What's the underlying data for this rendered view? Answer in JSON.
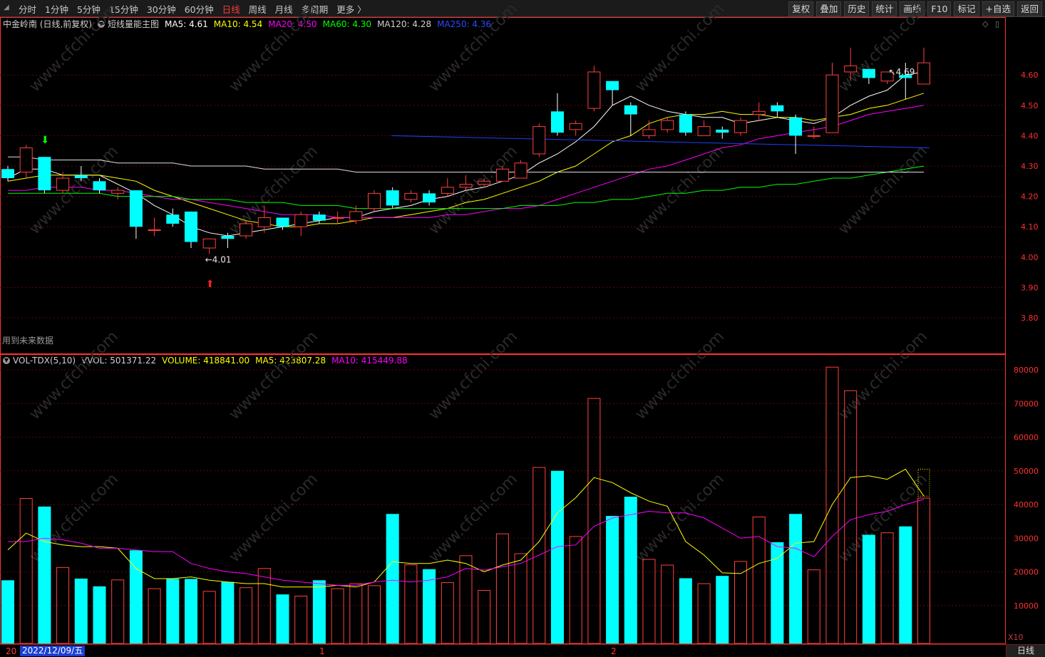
{
  "toolbar": {
    "periods": [
      {
        "label": "分时"
      },
      {
        "label": "1分钟"
      },
      {
        "label": "5分钟"
      },
      {
        "label": "15分钟"
      },
      {
        "label": "30分钟"
      },
      {
        "label": "60分钟"
      },
      {
        "label": "日线",
        "active": true
      },
      {
        "label": "周线"
      },
      {
        "label": "月线"
      },
      {
        "label": "多周期"
      },
      {
        "label": "更多 〉"
      }
    ],
    "buttons": [
      {
        "label": "复权"
      },
      {
        "label": "叠加"
      },
      {
        "label": "历史"
      },
      {
        "label": "统计"
      },
      {
        "label": "画线"
      },
      {
        "label": "F10"
      },
      {
        "label": "标记"
      },
      {
        "label": "+自选"
      },
      {
        "label": "返回"
      }
    ]
  },
  "main_legend": {
    "title": "中金岭南 (日线,前复权)",
    "indicator": "短线量能主图",
    "ma5": "MA5: 4.61",
    "ma10": "MA10: 4.54",
    "ma20": "MA20: 4.50",
    "ma60": "MA60: 4.30",
    "ma120": "MA120: 4.28",
    "ma250": "MA250: 4.36"
  },
  "vol_legend": {
    "name": "VOL-TDX(5,10)",
    "vvol": "VVOL: 501371.22",
    "volume": "VOLUME: 418841.00",
    "ma5": "MA5: 423807.28",
    "ma10": "MA10: 415449.88"
  },
  "future_data_note": "用到未来数据",
  "bottom": {
    "date": "2022/12/09/五",
    "year_prefix": "20",
    "month1": "1",
    "month2": "2",
    "period": "日线"
  },
  "x10_label": "X10",
  "colors": {
    "up": "#ff4040",
    "down": "#00ffff",
    "ma5": "#ffffff",
    "ma10": "#ffff00",
    "ma20": "#ff00ff",
    "ma60": "#00ff00",
    "ma120": "#e0e0e0",
    "ma250": "#2040ff",
    "grid": "#5a0a0a",
    "axis": "#ff3030"
  },
  "chart_data": [
    {
      "type": "candlestick",
      "title": "短线量能主图",
      "y_ticks": [
        3.8,
        3.9,
        4.0,
        4.1,
        4.2,
        4.3,
        4.4,
        4.5,
        4.6
      ],
      "ylim": [
        3.75,
        4.78
      ],
      "annotations": [
        {
          "text": "4.69",
          "at_index": 48
        },
        {
          "text": "4.01",
          "at_index": 11
        }
      ],
      "signals": [
        {
          "type": "sell-arrow",
          "index": 2
        },
        {
          "type": "buy-arrow",
          "index": 11
        }
      ],
      "candles": [
        {
          "o": 4.29,
          "c": 4.26,
          "h": 4.3,
          "l": 4.25
        },
        {
          "o": 4.28,
          "c": 4.36,
          "h": 4.37,
          "l": 4.26
        },
        {
          "o": 4.33,
          "c": 4.22,
          "h": 4.33,
          "l": 4.21
        },
        {
          "o": 4.22,
          "c": 4.26,
          "h": 4.28,
          "l": 4.21
        },
        {
          "o": 4.27,
          "c": 4.26,
          "h": 4.3,
          "l": 4.25
        },
        {
          "o": 4.25,
          "c": 4.22,
          "h": 4.26,
          "l": 4.21
        },
        {
          "o": 4.21,
          "c": 4.22,
          "h": 4.23,
          "l": 4.19
        },
        {
          "o": 4.22,
          "c": 4.1,
          "h": 4.22,
          "l": 4.06
        },
        {
          "o": 4.09,
          "c": 4.09,
          "h": 4.13,
          "l": 4.07
        },
        {
          "o": 4.14,
          "c": 4.11,
          "h": 4.16,
          "l": 4.1
        },
        {
          "o": 4.15,
          "c": 4.05,
          "h": 4.15,
          "l": 4.03
        },
        {
          "o": 4.03,
          "c": 4.06,
          "h": 4.06,
          "l": 4.01
        },
        {
          "o": 4.07,
          "c": 4.06,
          "h": 4.08,
          "l": 4.03
        },
        {
          "o": 4.07,
          "c": 4.11,
          "h": 4.12,
          "l": 4.06
        },
        {
          "o": 4.1,
          "c": 4.13,
          "h": 4.17,
          "l": 4.08
        },
        {
          "o": 4.13,
          "c": 4.1,
          "h": 4.13,
          "l": 4.09
        },
        {
          "o": 4.1,
          "c": 4.14,
          "h": 4.15,
          "l": 4.07
        },
        {
          "o": 4.14,
          "c": 4.12,
          "h": 4.15,
          "l": 4.11
        },
        {
          "o": 4.13,
          "c": 4.13,
          "h": 4.15,
          "l": 4.11
        },
        {
          "o": 4.12,
          "c": 4.15,
          "h": 4.17,
          "l": 4.11
        },
        {
          "o": 4.16,
          "c": 4.21,
          "h": 4.22,
          "l": 4.15
        },
        {
          "o": 4.22,
          "c": 4.17,
          "h": 4.23,
          "l": 4.16
        },
        {
          "o": 4.19,
          "c": 4.21,
          "h": 4.22,
          "l": 4.18
        },
        {
          "o": 4.21,
          "c": 4.18,
          "h": 4.22,
          "l": 4.17
        },
        {
          "o": 4.21,
          "c": 4.23,
          "h": 4.26,
          "l": 4.2
        },
        {
          "o": 4.23,
          "c": 4.24,
          "h": 4.27,
          "l": 4.22
        },
        {
          "o": 4.24,
          "c": 4.25,
          "h": 4.26,
          "l": 4.23
        },
        {
          "o": 4.25,
          "c": 4.29,
          "h": 4.3,
          "l": 4.25
        },
        {
          "o": 4.26,
          "c": 4.31,
          "h": 4.32,
          "l": 4.26
        },
        {
          "o": 4.34,
          "c": 4.43,
          "h": 4.44,
          "l": 4.33
        },
        {
          "o": 4.48,
          "c": 4.41,
          "h": 4.54,
          "l": 4.4
        },
        {
          "o": 4.42,
          "c": 4.44,
          "h": 4.45,
          "l": 4.4
        },
        {
          "o": 4.49,
          "c": 4.61,
          "h": 4.63,
          "l": 4.48
        },
        {
          "o": 4.58,
          "c": 4.55,
          "h": 4.58,
          "l": 4.5
        },
        {
          "o": 4.5,
          "c": 4.47,
          "h": 4.51,
          "l": 4.4
        },
        {
          "o": 4.4,
          "c": 4.42,
          "h": 4.45,
          "l": 4.39
        },
        {
          "o": 4.42,
          "c": 4.45,
          "h": 4.46,
          "l": 4.41
        },
        {
          "o": 4.47,
          "c": 4.41,
          "h": 4.48,
          "l": 4.4
        },
        {
          "o": 4.4,
          "c": 4.43,
          "h": 4.45,
          "l": 4.4
        },
        {
          "o": 4.42,
          "c": 4.41,
          "h": 4.43,
          "l": 4.39
        },
        {
          "o": 4.41,
          "c": 4.45,
          "h": 4.46,
          "l": 4.4
        },
        {
          "o": 4.47,
          "c": 4.48,
          "h": 4.51,
          "l": 4.45
        },
        {
          "o": 4.5,
          "c": 4.48,
          "h": 4.51,
          "l": 4.46
        },
        {
          "o": 4.46,
          "c": 4.4,
          "h": 4.47,
          "l": 4.34
        },
        {
          "o": 4.4,
          "c": 4.4,
          "h": 4.43,
          "l": 4.39
        },
        {
          "o": 4.41,
          "c": 4.6,
          "h": 4.64,
          "l": 4.41
        },
        {
          "o": 4.61,
          "c": 4.63,
          "h": 4.69,
          "l": 4.58
        },
        {
          "o": 4.62,
          "c": 4.59,
          "h": 4.62,
          "l": 4.57
        },
        {
          "o": 4.58,
          "c": 4.61,
          "h": 4.61,
          "l": 4.57
        },
        {
          "o": 4.6,
          "c": 4.59,
          "h": 4.64,
          "l": 4.52
        },
        {
          "o": 4.57,
          "c": 4.64,
          "h": 4.69,
          "l": 4.57
        }
      ],
      "ma_lines": {
        "ma5": [
          4.26,
          4.29,
          4.29,
          4.27,
          4.27,
          4.27,
          4.24,
          4.21,
          4.17,
          4.14,
          4.1,
          4.08,
          4.07,
          4.08,
          4.09,
          4.1,
          4.11,
          4.12,
          4.13,
          4.13,
          4.15,
          4.16,
          4.17,
          4.19,
          4.2,
          4.22,
          4.23,
          4.25,
          4.27,
          4.31,
          4.34,
          4.38,
          4.43,
          4.5,
          4.53,
          4.5,
          4.48,
          4.47,
          4.46,
          4.46,
          4.44,
          4.45,
          4.46,
          4.45,
          4.44,
          4.46,
          4.5,
          4.53,
          4.55,
          4.6,
          4.61
        ],
        "ma10": [
          4.25,
          4.26,
          4.27,
          4.27,
          4.27,
          4.27,
          4.26,
          4.25,
          4.22,
          4.2,
          4.18,
          4.16,
          4.14,
          4.12,
          4.11,
          4.1,
          4.1,
          4.11,
          4.11,
          4.12,
          4.13,
          4.13,
          4.14,
          4.15,
          4.16,
          4.18,
          4.19,
          4.21,
          4.23,
          4.25,
          4.28,
          4.3,
          4.34,
          4.38,
          4.4,
          4.44,
          4.46,
          4.47,
          4.47,
          4.48,
          4.47,
          4.47,
          4.46,
          4.46,
          4.45,
          4.46,
          4.47,
          4.49,
          4.5,
          4.52,
          4.54
        ],
        "ma20": [
          4.22,
          4.22,
          4.23,
          4.23,
          4.23,
          4.22,
          4.22,
          4.21,
          4.2,
          4.19,
          4.19,
          4.18,
          4.17,
          4.16,
          4.15,
          4.14,
          4.14,
          4.14,
          4.13,
          4.13,
          4.13,
          4.13,
          4.13,
          4.13,
          4.14,
          4.14,
          4.15,
          4.16,
          4.16,
          4.17,
          4.19,
          4.21,
          4.23,
          4.25,
          4.27,
          4.29,
          4.3,
          4.32,
          4.34,
          4.36,
          4.37,
          4.39,
          4.4,
          4.41,
          4.42,
          4.43,
          4.45,
          4.47,
          4.48,
          4.49,
          4.5
        ],
        "ma60": [
          4.21,
          4.21,
          4.21,
          4.21,
          4.21,
          4.21,
          4.2,
          4.2,
          4.2,
          4.2,
          4.19,
          4.19,
          4.19,
          4.18,
          4.18,
          4.18,
          4.17,
          4.17,
          4.17,
          4.16,
          4.16,
          4.16,
          4.16,
          4.16,
          4.16,
          4.16,
          4.16,
          4.16,
          4.17,
          4.17,
          4.17,
          4.18,
          4.18,
          4.19,
          4.19,
          4.2,
          4.21,
          4.21,
          4.22,
          4.22,
          4.23,
          4.23,
          4.24,
          4.24,
          4.25,
          4.26,
          4.26,
          4.27,
          4.28,
          4.29,
          4.3
        ],
        "ma120": [
          4.33,
          4.33,
          4.32,
          4.32,
          4.32,
          4.32,
          4.31,
          4.31,
          4.31,
          4.31,
          4.3,
          4.3,
          4.3,
          4.3,
          4.29,
          4.29,
          4.29,
          4.29,
          4.29,
          4.28,
          4.28,
          4.28,
          4.28,
          4.28,
          4.28,
          4.28,
          4.28,
          4.28,
          4.28,
          4.28,
          4.28,
          4.28,
          4.28,
          4.28,
          4.28,
          4.28,
          4.28,
          4.28,
          4.28,
          4.28,
          4.28,
          4.28,
          4.28,
          4.28,
          4.28,
          4.28,
          4.28,
          4.28,
          4.28,
          4.28,
          4.28
        ],
        "ma250": [
          null,
          null,
          null,
          null,
          null,
          null,
          null,
          null,
          null,
          null,
          null,
          null,
          null,
          null,
          null,
          null,
          null,
          null,
          null,
          null,
          null,
          4.4,
          4.4,
          4.4,
          4.4,
          4.4,
          4.4,
          4.39,
          4.39,
          4.39,
          4.39,
          4.39,
          4.38,
          4.38,
          4.38,
          4.38,
          4.37,
          4.37,
          4.37,
          4.37,
          4.37,
          4.37,
          4.37,
          4.37,
          4.37,
          4.37,
          4.37,
          4.37,
          4.37,
          4.36,
          4.36
        ]
      }
    },
    {
      "type": "bar",
      "title": "VOL-TDX(5,10)",
      "y_ticks": [
        10000,
        20000,
        30000,
        40000,
        50000,
        60000,
        70000,
        80000
      ],
      "ylim": [
        0,
        85000
      ],
      "volumes": [
        17500,
        41800,
        39400,
        21300,
        18000,
        15700,
        17600,
        26400,
        15000,
        17900,
        17900,
        14200,
        17000,
        15300,
        21000,
        13300,
        12800,
        17500,
        15000,
        16500,
        15900,
        37200,
        22100,
        20800,
        16800,
        24800,
        14500,
        31300,
        25400,
        51000,
        50000,
        30500,
        71500,
        36600,
        42300,
        23700,
        22000,
        18100,
        16500,
        18800,
        23100,
        36300,
        28800,
        37200,
        20600,
        80800,
        73800,
        31000,
        31600,
        33500,
        41900
      ],
      "ma5": [
        26500,
        31500,
        29000,
        28000,
        27500,
        27500,
        27000,
        21000,
        18000,
        18000,
        18500,
        17500,
        17000,
        16500,
        16500,
        15500,
        15500,
        15500,
        16000,
        15500,
        17000,
        23000,
        22500,
        22500,
        23500,
        22500,
        20000,
        22000,
        23500,
        29000,
        37500,
        42000,
        48000,
        46500,
        43500,
        41000,
        39500,
        29000,
        25000,
        19700,
        19500,
        22500,
        24000,
        28500,
        29000,
        40000,
        48000,
        48500,
        47500,
        50500,
        42500
      ],
      "ma10": [
        29000,
        29000,
        30000,
        29500,
        28500,
        27000,
        27000,
        26500,
        26000,
        26000,
        22500,
        21000,
        20000,
        19500,
        18500,
        17500,
        17000,
        16500,
        16000,
        16000,
        17000,
        17500,
        17000,
        17500,
        18500,
        21000,
        20500,
        21500,
        22500,
        25000,
        27500,
        28000,
        33500,
        36000,
        37000,
        38000,
        37500,
        37500,
        36000,
        33000,
        30000,
        30500,
        27500,
        27000,
        24500,
        30500,
        35500,
        37000,
        38000,
        40000,
        41500
      ]
    }
  ]
}
